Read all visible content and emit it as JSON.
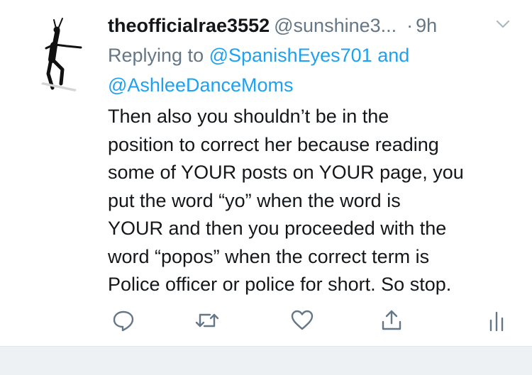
{
  "tweet": {
    "display_name": "theofficialrae3552",
    "handle": "@sunshine3...",
    "separator": "·",
    "time": "9h",
    "replying_prefix": "Replying to",
    "mention_1": "@SpanishEyes701",
    "conjunction": "and",
    "mention_2": "@AshleeDanceMoms",
    "body_lines": [
      "Then also you shouldn’t be in the",
      "position to correct her because reading",
      "some of YOUR posts on YOUR page, you",
      "put the word “yo” when the word is",
      "YOUR and then you proceeded with the",
      "word “popos” when the correct term is",
      "Police officer or police for short. So stop."
    ]
  },
  "actions": {
    "icons": [
      "reply-icon",
      "retweet-icon",
      "like-icon",
      "share-icon",
      "analytics-icon"
    ]
  },
  "colors": {
    "text": "#14171a",
    "secondary": "#657786",
    "link": "#1da1f2",
    "bar": "#eef1f4"
  }
}
